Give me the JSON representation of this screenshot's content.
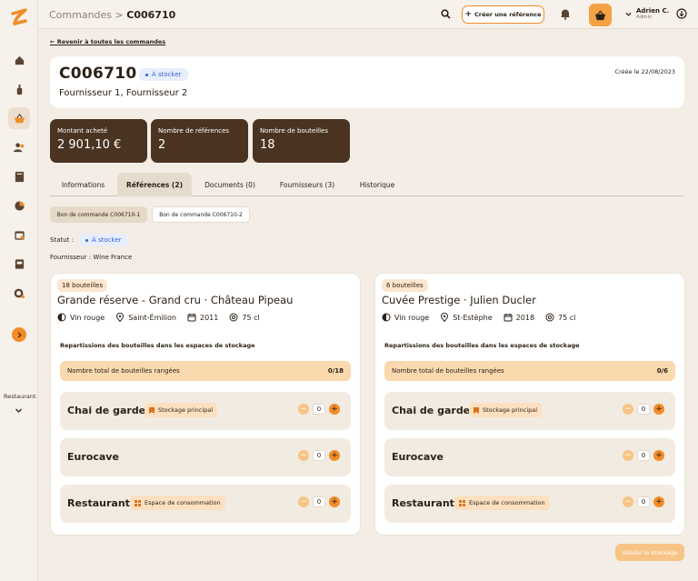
{
  "sidebar": {
    "items": [
      {
        "icon": "home-icon"
      },
      {
        "icon": "bottle-icon"
      },
      {
        "icon": "basket-icon",
        "active": true
      },
      {
        "icon": "users-icon"
      },
      {
        "icon": "book-icon"
      },
      {
        "icon": "pie-chart-icon"
      },
      {
        "icon": "calendar-icon"
      },
      {
        "icon": "wine-box-icon"
      },
      {
        "icon": "settings-icon"
      }
    ],
    "restaurant_label": "Restaurant"
  },
  "topbar": {
    "breadcrumb_parent": "Commandes",
    "breadcrumb_sep": ">",
    "breadcrumb_current": "C006710",
    "create_label": "Créer une référence",
    "user_name": "Adrien C.",
    "user_role": "Admin"
  },
  "back_link": "Revenir à toutes les commandes",
  "order": {
    "code": "C006710",
    "status": "À stocker",
    "suppliers": "Fournisseur 1, Fournisseur 2",
    "created": "Créée le 22/08/2023"
  },
  "stats": [
    {
      "label": "Montant acheté",
      "value": "2 901,10 €"
    },
    {
      "label": "Nombre de références",
      "value": "2"
    },
    {
      "label": "Nombre de bouteilles",
      "value": "18"
    }
  ],
  "tabs": [
    {
      "label": "Informations"
    },
    {
      "label": "Références (2)",
      "active": true
    },
    {
      "label": "Documents (0)"
    },
    {
      "label": "Fournisseurs (3)"
    },
    {
      "label": "Historique"
    }
  ],
  "purchase_orders": [
    {
      "label": "Bon de commande C006710-1",
      "active": true
    },
    {
      "label": "Bon de commande C006710-2"
    }
  ],
  "status_label": "Statut :",
  "status_value": "À stocker",
  "fournisseur_line": "Fournisseur : Wine France",
  "products": [
    {
      "qty": "18 bouteilles",
      "name": "Grande réserve - Grand cru · Château Pipeau",
      "color": "Vin rouge",
      "region": "Saint-Émilion",
      "year": "2011",
      "volume": "75 cl",
      "rep_title": "Repartissions des bouteilles dans les espaces de stockage",
      "total_label": "Nombre total de bouteilles rangées",
      "total_count": "0/18",
      "spaces": [
        {
          "name": "Chai de garde",
          "tag": "Stockage principal",
          "tag_icon": "bookmark-icon",
          "value": "0"
        },
        {
          "name": "Eurocave",
          "tag": "",
          "value": "0"
        },
        {
          "name": "Restaurant",
          "tag": "Espace de consommation",
          "tag_icon": "grid-icon",
          "value": "0"
        }
      ]
    },
    {
      "qty": "6 bouteilles",
      "name": "Cuvée Prestige · Julien Ducler",
      "color": "Vin rouge",
      "region": "St-Estèphe",
      "year": "2018",
      "volume": "75 cl",
      "rep_title": "Repartissions des bouteilles dans les espaces de stockage",
      "total_label": "Nombre total de bouteilles rangées",
      "total_count": "0/6",
      "spaces": [
        {
          "name": "Chai de garde",
          "tag": "Stockage principal",
          "tag_icon": "bookmark-icon",
          "value": "0"
        },
        {
          "name": "Eurocave",
          "tag": "",
          "value": "0"
        },
        {
          "name": "Restaurant",
          "tag": "Espace de consommation",
          "tag_icon": "grid-icon",
          "value": "0"
        }
      ]
    }
  ],
  "validate_label": "Valider le stockage",
  "colors": {
    "accent": "#f28c28",
    "dark_card": "#4a3421",
    "background": "#f3ede6",
    "badge_blue": "#3563d6"
  }
}
